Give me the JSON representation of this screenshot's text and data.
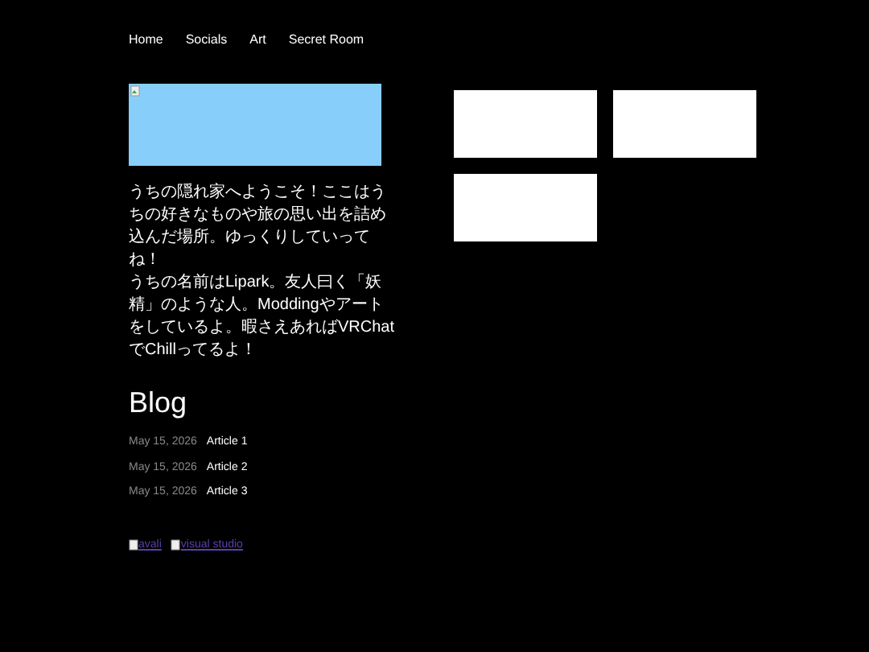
{
  "nav": [
    {
      "label": "Home"
    },
    {
      "label": "Socials"
    },
    {
      "label": "Art"
    },
    {
      "label": "Secret Room"
    }
  ],
  "banner": {
    "kind": "picture"
  },
  "intro": [
    "うちの隠れ家へようこそ！ここはうちの好きなものや旅の思い出を詰め込んだ場所。ゆっくりしていってね！",
    "うちの名前はLipark。友人曰く「妖精」のような人。Moddingやアートをしているよ。暇さえあればVRChatでChillってるよ！"
  ],
  "blog": {
    "title": "Blog",
    "posts": [
      {
        "date": "May 15, 2026",
        "title": "Article 1"
      },
      {
        "date": "May 15, 2026",
        "title": "Article 2"
      },
      {
        "date": "May 15, 2026",
        "title": "Article 3"
      }
    ]
  },
  "badges": [
    {
      "alt": "avali"
    },
    {
      "alt": "visual studio"
    }
  ],
  "cards": [
    {
      "kind": "blank"
    },
    {
      "kind": "blank"
    },
    {
      "kind": "blank"
    }
  ]
}
